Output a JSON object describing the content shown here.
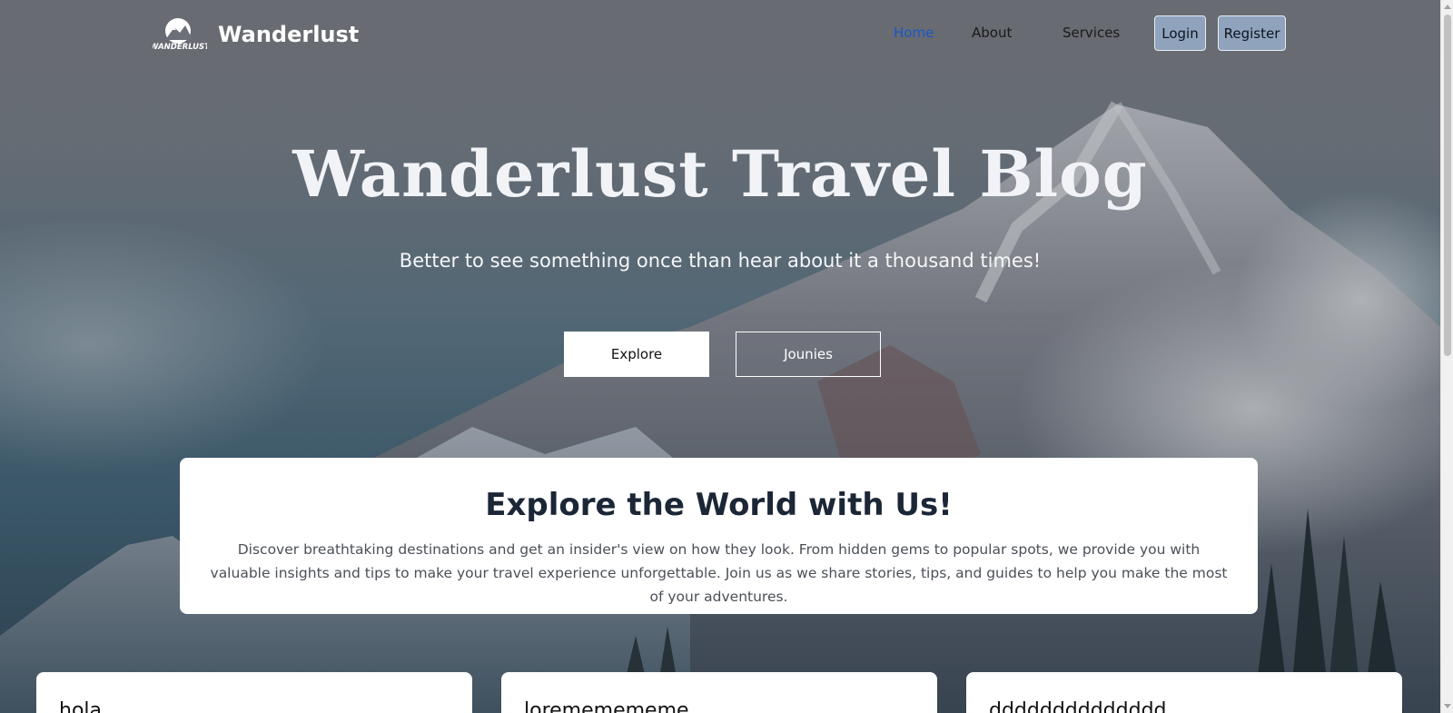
{
  "navbar": {
    "brand_name": "Wanderlust",
    "logo_text": "WANDERLUST",
    "links": [
      {
        "label": "Home",
        "active": true
      },
      {
        "label": "About",
        "active": false
      },
      {
        "label": "Services",
        "active": false
      }
    ],
    "login_label": "Login",
    "register_label": "Register"
  },
  "hero": {
    "title": "Wanderlust Travel Blog",
    "subtitle": "Better to see something once than hear about it a thousand times!",
    "explore_label": "Explore",
    "jounies_label": "Jounies"
  },
  "explore_section": {
    "title": "Explore the World with Us!",
    "text": "Discover breathtaking destinations and get an insider's view on how they look. From hidden gems to popular spots, we provide you with valuable insights and tips to make your travel experience unforgettable. Join us as we share stories, tips, and guides to help you make the most of your adventures."
  },
  "posts": [
    {
      "title": "hola"
    },
    {
      "title": "lorememememe"
    },
    {
      "title": "dddddddddddddd"
    }
  ],
  "colors": {
    "active_link": "#1a56c8",
    "auth_button_bg": "#8fa3bc",
    "heading_dark": "#1b2636"
  }
}
